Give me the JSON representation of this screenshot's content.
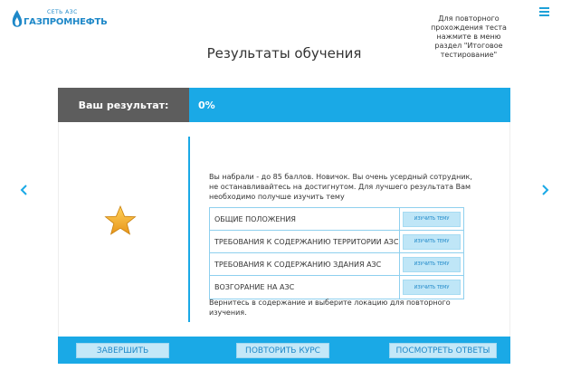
{
  "header": {
    "logo_small": "СЕТЬ АЗС",
    "logo_big": "ГАЗПРОМНЕФТЬ",
    "hint_text": "Для повторного прохождения теста нажмите в меню раздел \"Итоговое тестирование\"",
    "menu_icon": "hamburger-icon"
  },
  "page": {
    "title": "Результаты обучения"
  },
  "result": {
    "label": "Ваш результат:",
    "value": "0%"
  },
  "content": {
    "message": "Вы набрали - до 85 баллов. Новичок. Вы очень усердный сотрудник, не останавливайтесь на достигнутом. Для лучшего результата Вам необходимо получше изучить тему",
    "topics": [
      {
        "name": "ОБЩИЕ ПОЛОЖЕНИЯ",
        "button": "ИЗУЧИТЬ ТЕМУ"
      },
      {
        "name": "ТРЕБОВАНИЯ К СОДЕРЖАНИЮ ТЕРРИТОРИИ АЗС",
        "button": "ИЗУЧИТЬ ТЕМУ"
      },
      {
        "name": "ТРЕБОВАНИЯ К СОДЕРЖАНИЮ ЗДАНИЯ АЗС",
        "button": "ИЗУЧИТЬ ТЕМУ"
      },
      {
        "name": "ВОЗГОРАНИЕ НА АЗС",
        "button": "ИЗУЧИТЬ ТЕМУ"
      }
    ],
    "footer": "Вернитесь в содержание и выберите локацию для повторного изучения."
  },
  "actions": {
    "finish": "ЗАВЕРШИТЬ",
    "repeat": "ПОВТОРИТЬ КУРС",
    "answers": "ПОСМОТРЕТЬ ОТВЕТЫ"
  },
  "colors": {
    "accent": "#1aa9e6",
    "label_bg": "#5d5d5d",
    "star": "#f5a623"
  }
}
